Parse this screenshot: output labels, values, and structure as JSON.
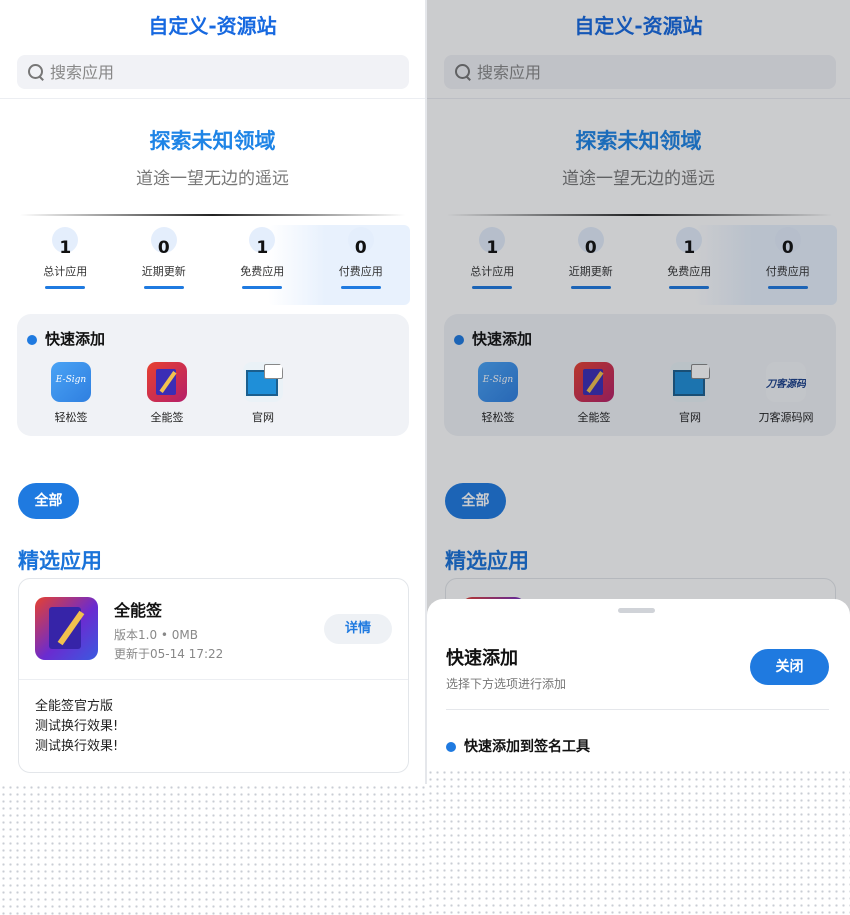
{
  "header": {
    "title": "自定义-资源站"
  },
  "search": {
    "placeholder": "搜索应用"
  },
  "hero": {
    "title": "探索未知领域",
    "subtitle": "道途一望无边的遥远"
  },
  "stats": [
    {
      "value": "1",
      "label": "总计应用"
    },
    {
      "value": "0",
      "label": "近期更新"
    },
    {
      "value": "1",
      "label": "免费应用"
    },
    {
      "value": "0",
      "label": "付费应用"
    }
  ],
  "quick_add": {
    "title": "快速添加",
    "items": [
      {
        "label": "轻松签",
        "icon": "esign-icon",
        "icon_text": "E-Sign"
      },
      {
        "label": "全能签",
        "icon": "allsign-icon"
      },
      {
        "label": "官网",
        "icon": "website-icon"
      },
      {
        "label": "刀客源码网",
        "icon": "daoke-icon",
        "icon_text": "刀客源码"
      }
    ]
  },
  "tabs": {
    "all": "全部"
  },
  "featured": {
    "title": "精选应用",
    "app": {
      "name": "全能签",
      "meta": "版本1.0 • 0MB",
      "updated": "更新于05-14 17:22",
      "details_label": "详情",
      "description": [
        "全能签官方版",
        "测试换行效果!",
        "测试换行效果!"
      ]
    }
  },
  "sheet": {
    "title": "快速添加",
    "subtitle": "选择下方选项进行添加",
    "close_label": "关闭",
    "section": "快速添加到签名工具"
  },
  "colors": {
    "accent": "#1f7ae0",
    "title_blue": "#1769e0"
  }
}
